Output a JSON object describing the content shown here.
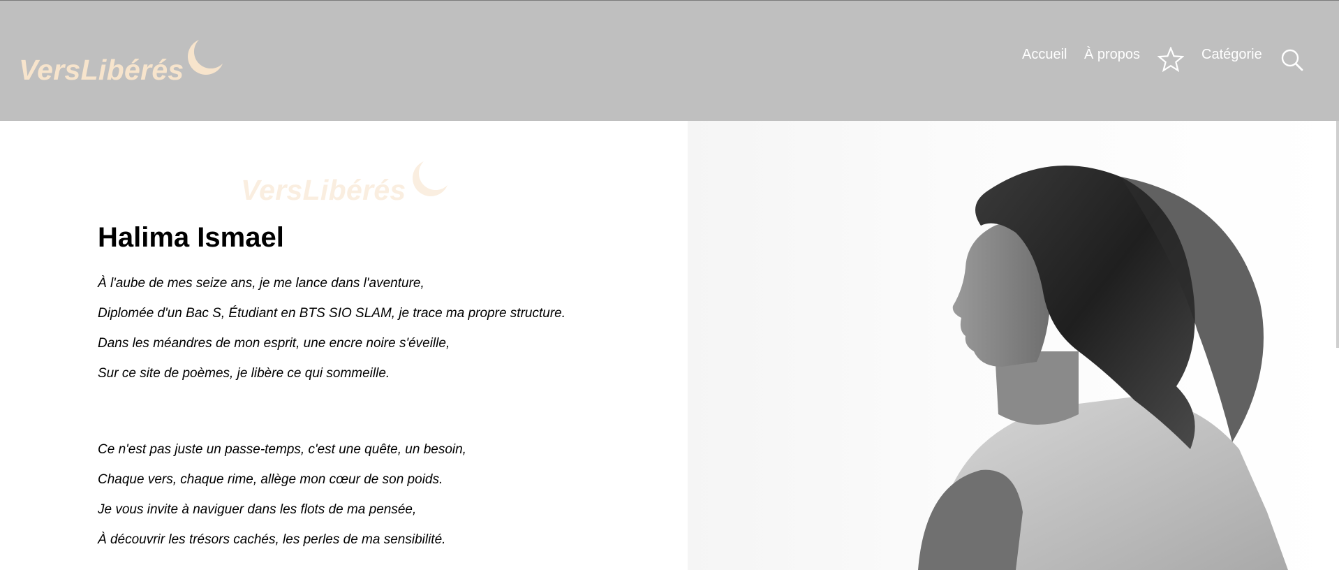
{
  "header": {
    "logo_text": "VersLibérés",
    "nav": {
      "home": "Accueil",
      "about": "À propos",
      "category": "Catégorie"
    },
    "icons": {
      "favorites": "star-icon",
      "search": "search-icon",
      "logo": "moon-icon"
    }
  },
  "main": {
    "logo_text": "VersLibérés",
    "author_name": "Halima Ismael",
    "stanza1": [
      "À l'aube de mes seize ans, je me lance dans l'aventure,",
      "Diplomée d'un Bac S, Étudiant en BTS SIO SLAM, je trace ma propre structure.",
      "Dans les méandres de mon esprit, une encre noire s'éveille,",
      "Sur ce site de poèmes, je libère ce qui sommeille."
    ],
    "stanza2": [
      "Ce n'est pas juste un passe-temps, c'est une quête, un besoin,",
      "Chaque vers, chaque rime, allège mon cœur de son poids.",
      "Je vous invite à naviguer dans les flots de ma pensée,",
      "À découvrir les trésors cachés, les perles de ma sensibilité."
    ]
  },
  "colors": {
    "header_bg": "#bfbfbf",
    "logo": "#f7e4cc",
    "logo_faded": "#faeee0",
    "nav_text": "#ffffff",
    "body_text": "#000000"
  }
}
